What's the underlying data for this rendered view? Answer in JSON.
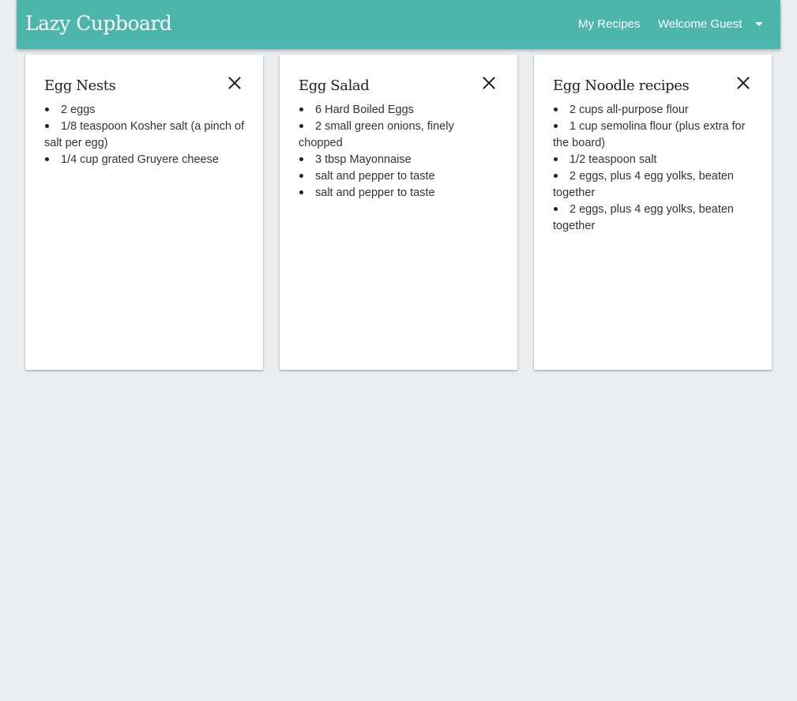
{
  "header": {
    "brand": "Lazy Cupboard",
    "my_recipes": "My Recipes",
    "welcome": "Welcome Guest"
  },
  "cards": [
    {
      "title": "Egg Nests",
      "ingredients": [
        "2 eggs",
        "1/8 teaspoon Kosher salt (a pinch of salt per egg)",
        "1/4 cup grated Gruyere cheese"
      ]
    },
    {
      "title": "Egg Salad",
      "ingredients": [
        "6 Hard Boiled Eggs",
        "2 small green onions, finely chopped",
        "3 tbsp Mayonnaise",
        "salt and pepper to taste",
        "salt and pepper to taste"
      ]
    },
    {
      "title": "Egg Noodle recipes",
      "ingredients": [
        "2 cups all-purpose flour",
        "1 cup semolina flour (plus extra for the board)",
        "1/2 teaspoon salt",
        "2 eggs, plus 4 egg yolks, beaten together",
        "2 eggs, plus 4 egg yolks, beaten together"
      ]
    }
  ],
  "colors": {
    "header_bg": "#4db6ac",
    "page_bg": "#eaeef1",
    "card_bg": "#ffffff"
  },
  "icons": {
    "close": "close-icon",
    "dropdown": "caret-down-icon"
  }
}
